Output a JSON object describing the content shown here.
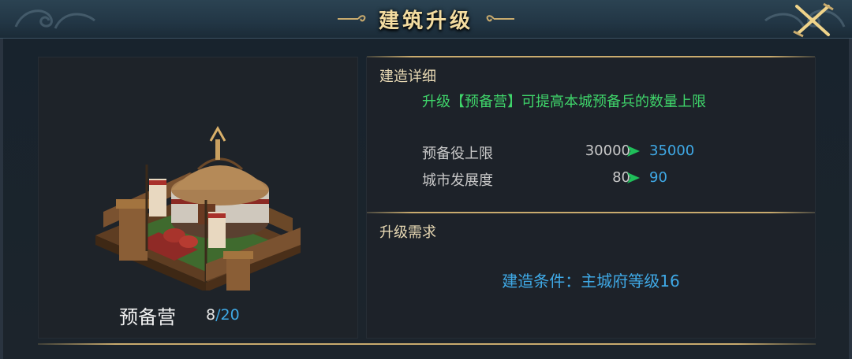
{
  "window": {
    "title": "建筑升级",
    "close_icon": "crossed-swords-icon"
  },
  "building": {
    "name": "预备营",
    "level_current": "8",
    "level_separator": "/",
    "level_max": "20",
    "image_icon": "yurt-camp-icon"
  },
  "details": {
    "heading": "建造详细",
    "description": "升级【预备营】可提高本城预备兵的数量上限",
    "stats": [
      {
        "label": "预备役上限",
        "old": "30000",
        "new": "35000"
      },
      {
        "label": "城市发展度",
        "old": "80",
        "new": "90"
      }
    ],
    "arrow_icon": "green-arrow-right-icon"
  },
  "requirements": {
    "heading": "升级需求",
    "condition": "建造条件：主城府等级16"
  },
  "colors": {
    "title_gold": "#f3dca0",
    "desc_green": "#3fd46a",
    "value_blue": "#3fa9e6",
    "arrow_green": "#1fbf5a",
    "divider_gold": "#c9ab6e"
  }
}
